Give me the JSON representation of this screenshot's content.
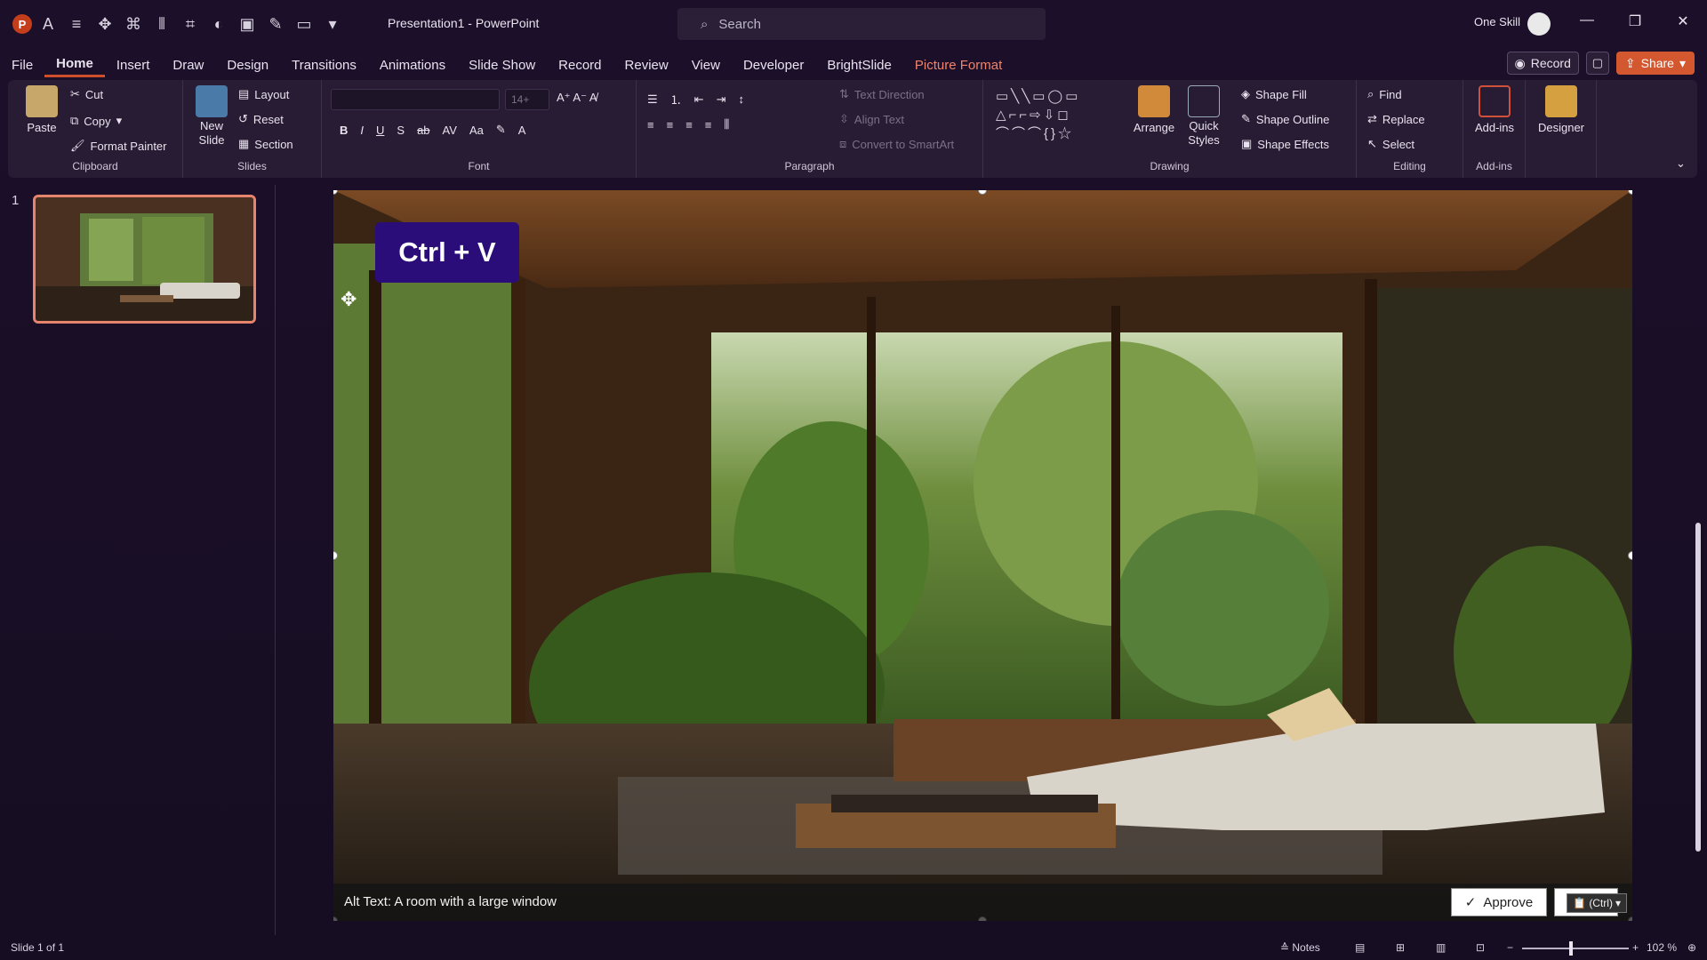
{
  "titlebar": {
    "doc_title": "Presentation1  -  PowerPoint",
    "search_placeholder": "Search",
    "user_name": "One Skill"
  },
  "tabs": [
    "File",
    "Home",
    "Insert",
    "Draw",
    "Design",
    "Transitions",
    "Animations",
    "Slide Show",
    "Record",
    "Review",
    "View",
    "Developer",
    "BrightSlide",
    "Picture Format"
  ],
  "right_buttons": {
    "record": "Record",
    "share": "Share"
  },
  "ribbon": {
    "clipboard": {
      "paste": "Paste",
      "cut": "Cut",
      "copy": "Copy",
      "format_painter": "Format Painter",
      "label": "Clipboard"
    },
    "slides": {
      "new_slide_1": "New",
      "new_slide_2": "Slide",
      "layout": "Layout",
      "reset": "Reset",
      "section": "Section",
      "label": "Slides"
    },
    "font": {
      "size": "14+",
      "label": "Font"
    },
    "paragraph": {
      "text_direction": "Text Direction",
      "align_text": "Align Text",
      "convert_smartart": "Convert to SmartArt",
      "label": "Paragraph"
    },
    "drawing": {
      "arrange": "Arrange",
      "quick_styles_1": "Quick",
      "quick_styles_2": "Styles",
      "shape_fill": "Shape Fill",
      "shape_outline": "Shape Outline",
      "shape_effects": "Shape Effects",
      "label": "Drawing"
    },
    "editing": {
      "find": "Find",
      "replace": "Replace",
      "select": "Select",
      "label": "Editing"
    },
    "addins": {
      "addins": "Add-ins",
      "label": "Add-ins"
    },
    "designer": {
      "designer": "Designer"
    }
  },
  "slide_panel": {
    "number": "1"
  },
  "slide": {
    "overlay_text": "Ctrl + V",
    "alt_text": "Alt Text: A room with a large window",
    "approve": "Approve",
    "paste_chip": "(Ctrl)"
  },
  "status": {
    "slide_count": "Slide 1 of 1",
    "notes": "Notes",
    "zoom": "102 %"
  },
  "colors": {
    "accent": "#d04f2b",
    "picture_format": "#f0836a",
    "ctrlv_bg": "#2a0d78"
  }
}
